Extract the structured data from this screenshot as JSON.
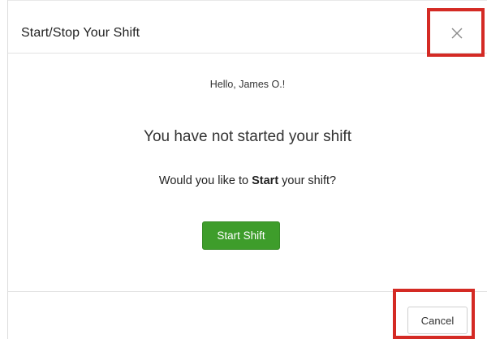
{
  "modal": {
    "title": "Start/Stop Your Shift",
    "close_icon": "close-icon"
  },
  "body": {
    "greeting": "Hello, James O.!",
    "status": "You have not started your shift",
    "question_prefix": "Would you like to ",
    "question_bold": "Start",
    "question_suffix": " your shift?",
    "start_label": "Start Shift"
  },
  "footer": {
    "cancel_label": "Cancel"
  },
  "colors": {
    "start_button": "#3e9d2b",
    "highlight": "#d42a24"
  }
}
